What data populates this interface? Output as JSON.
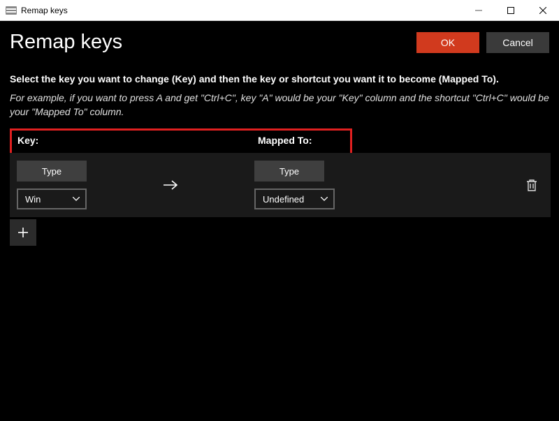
{
  "titlebar": {
    "title": "Remap keys"
  },
  "header": {
    "title": "Remap keys",
    "ok": "OK",
    "cancel": "Cancel"
  },
  "instructions": "Select the key you want to change (Key) and then the key or shortcut you want it to become (Mapped To).",
  "example": "For example, if you want to press A and get \"Ctrl+C\", key \"A\" would be your \"Key\" column and the shortcut \"Ctrl+C\" would be your \"Mapped To\" column.",
  "columns": {
    "key": "Key:",
    "mapped": "Mapped To:"
  },
  "row": {
    "typeBtn": "Type",
    "keyValue": "Win",
    "mappedValue": "Undefined"
  },
  "icons": {
    "arrow": "arrow-right-icon",
    "trash": "trash-icon",
    "plus": "plus-icon",
    "chevron": "chevron-down-icon"
  },
  "colors": {
    "primary": "#d13a1e",
    "highlight": "#e02020"
  }
}
